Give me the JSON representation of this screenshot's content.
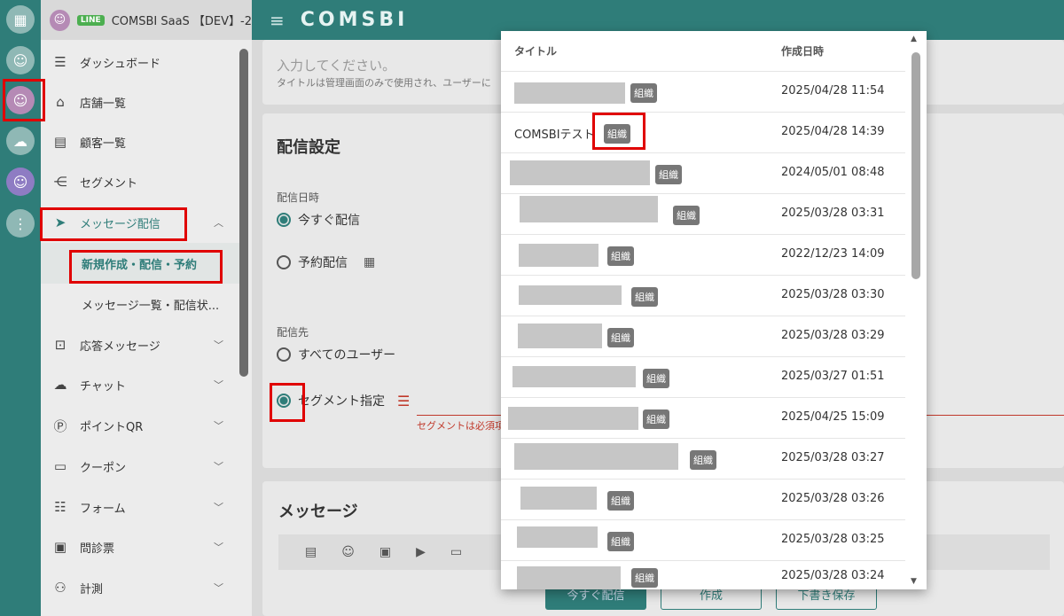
{
  "app": {
    "header_title": "COMSBI SaaS 【DEV】-2",
    "line_badge": "LINE",
    "brand": "COMSBI",
    "menu_icon": "hamburger-icon"
  },
  "rail": {
    "icons": [
      "building-icon",
      "smile-icon",
      "smile-icon",
      "chat-icon",
      "smile-icon",
      "more-icon"
    ]
  },
  "sidebar": {
    "items": [
      {
        "label": "ダッシュボード",
        "icon": "dashboard-icon"
      },
      {
        "label": "店舗一覧",
        "icon": "store-icon"
      },
      {
        "label": "顧客一覧",
        "icon": "id-card-icon"
      },
      {
        "label": "セグメント",
        "icon": "share-icon"
      },
      {
        "label": "メッセージ配信",
        "icon": "send-icon",
        "chevron": "^"
      },
      {
        "label": "応答メッセージ",
        "icon": "robot-icon",
        "chevron": "v"
      },
      {
        "label": "チャット",
        "icon": "chat-icon",
        "chevron": "v"
      },
      {
        "label": "ポイントQR",
        "icon": "point-icon",
        "chevron": "v"
      },
      {
        "label": "クーポン",
        "icon": "coupon-icon",
        "chevron": "v"
      },
      {
        "label": "フォーム",
        "icon": "form-icon",
        "chevron": "v"
      },
      {
        "label": "問診票",
        "icon": "clipboard-icon",
        "chevron": "v"
      },
      {
        "label": "計測",
        "icon": "measure-icon",
        "chevron": "v"
      }
    ],
    "sub_items": [
      {
        "label": "新規作成・配信・予約"
      },
      {
        "label": "メッセージ一覧・配信状..."
      }
    ]
  },
  "form": {
    "title_placeholder": "入力してください。",
    "title_hint": "タイトルは管理画面のみで使用され、ユーザーに",
    "delivery_section": "配信設定",
    "delivery_date_label": "配信日時",
    "now_option": "今すぐ配信",
    "scheduled_option": "予約配信",
    "target_label": "配信先",
    "all_users_option": "すべてのユーザー",
    "segment_option": "セグメント指定",
    "segment_error": "セグメントは必須項目",
    "message_section": "メッセージ",
    "buttons": {
      "send_now": "今すぐ配信",
      "create": "作成",
      "save_draft": "下書き保存"
    }
  },
  "modal": {
    "col_title": "タイトル",
    "col_date": "作成日時",
    "rows": [
      {
        "title": "",
        "badge": "組織",
        "date": "2025/04/28 11:54"
      },
      {
        "title": "COMSBIテスト",
        "badge": "組織",
        "date": "2025/04/28 14:39"
      },
      {
        "title": "",
        "badge": "組織",
        "date": "2024/05/01 08:48"
      },
      {
        "title": "",
        "badge": "組織",
        "date": "2025/03/28 03:31"
      },
      {
        "title": "",
        "badge": "組織",
        "date": "2022/12/23 14:09"
      },
      {
        "title": "",
        "badge": "組織",
        "date": "2025/03/28 03:30"
      },
      {
        "title": "",
        "badge": "組織",
        "date": "2025/03/28 03:29"
      },
      {
        "title": "",
        "badge": "組織",
        "date": "2025/03/27 01:51"
      },
      {
        "title": "",
        "badge": "組織",
        "date": "2025/04/25 15:09"
      },
      {
        "title": "",
        "badge": "組織",
        "date": "2025/03/28 03:27"
      },
      {
        "title": "",
        "badge": "組織",
        "date": "2025/03/28 03:26"
      },
      {
        "title": "",
        "badge": "組織",
        "date": "2025/03/28 03:25"
      },
      {
        "title": "",
        "badge": "組織",
        "date": "2025/03/28 03:24"
      }
    ]
  },
  "colors": {
    "accent": "#2f7d79",
    "error": "#c0392b",
    "highlight": "#e00000"
  }
}
